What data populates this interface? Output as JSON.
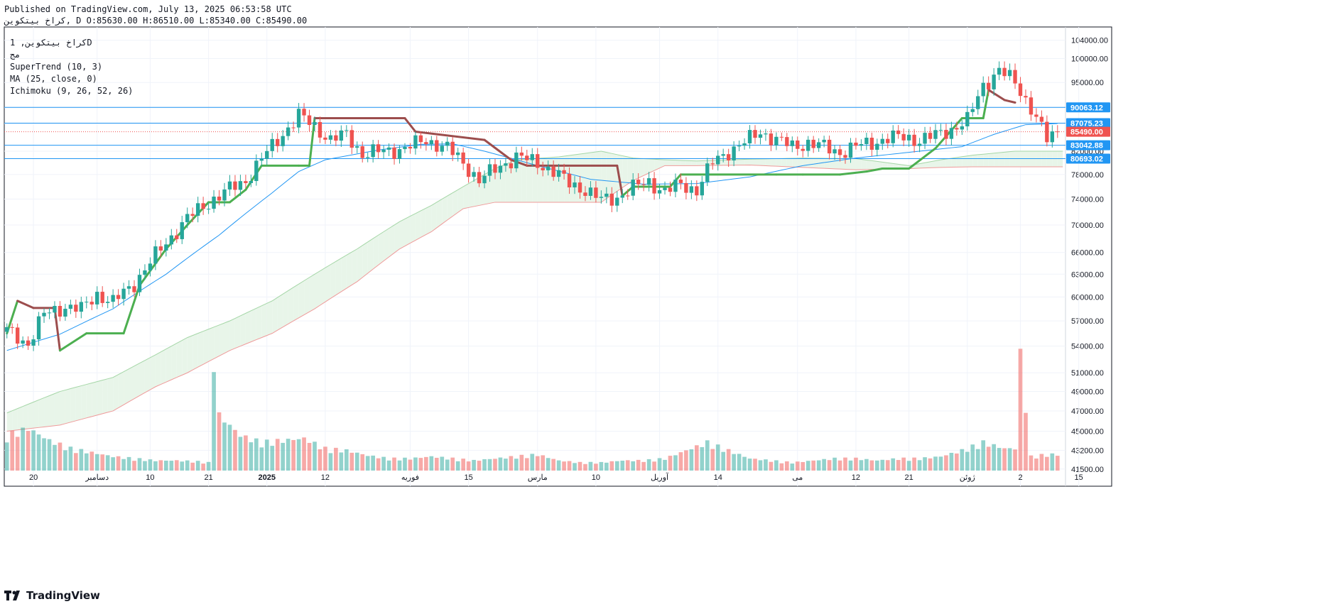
{
  "header": {
    "published": "Published on TradingView.com, July 13, 2025 06:53:58 UTC",
    "symbol_line": "كراخ بيتكوين, D O:85630.00 H:86510.00 L:85340.00 C:85490.00"
  },
  "legend": {
    "symbol": "كراخ بيتكوين, 1D",
    "exchange": "ﻣﺞ",
    "indicators": [
      "SuperTrend (10, 3)",
      "MA (25, close, 0)",
      "Ichimoku (9, 26, 52, 26)"
    ]
  },
  "footer": {
    "brand": "TradingView",
    "logo_icon": "tradingview-logo-icon"
  },
  "colors": {
    "up": "#26a69a",
    "down": "#ef5350",
    "supertrend_up": "#4caf50",
    "supertrend_down": "#9c4d4d",
    "ma": "#2196f3",
    "hline": "#2196f3",
    "current_price": "#ef5350",
    "cloud_bull": "#e8f5e9",
    "cloud_bear": "#fdecec",
    "span_a": "#a5d6a7",
    "span_b": "#ef9a9a"
  },
  "chart_data": {
    "type": "candlestick",
    "timeframe": "1D",
    "scale": "log",
    "ylim": [
      40000,
      107000
    ],
    "y_ticks": [
      "104000.00",
      "100000.00",
      "95000.00",
      "90000.00",
      "87000.00",
      "82000.00",
      "78000.00",
      "74000.00",
      "70000.00",
      "66000.00",
      "63000.00",
      "60000.00",
      "57000.00",
      "54000.00",
      "51000.00",
      "49000.00",
      "47000.00",
      "45000.00",
      "43200.00",
      "41500.00"
    ],
    "x_ticks": [
      "20",
      "دسامبر",
      "10",
      "21",
      "2025",
      "12",
      "فوريه",
      "15",
      "مارس",
      "10",
      "آوريل",
      "14",
      "مى",
      "12",
      "21",
      "ژوئن",
      "2",
      "15"
    ],
    "x_tick_index": [
      5,
      17,
      27,
      38,
      49,
      60,
      76,
      87,
      100,
      111,
      123,
      134,
      149,
      160,
      170,
      181,
      191,
      202
    ],
    "price_lines": [
      {
        "price": 90063.12,
        "label": "90063.12",
        "style": "solid"
      },
      {
        "price": 87075.23,
        "label": "87075.23",
        "style": "solid"
      },
      {
        "price": 85490.0,
        "label": "85490.00",
        "style": "dotted",
        "current": true
      },
      {
        "price": 83042.88,
        "label": "83042.88",
        "style": "solid"
      },
      {
        "price": 80693.02,
        "label": "80693.02",
        "style": "solid"
      }
    ],
    "ohlc_sample_count": 199,
    "last_ohlc": {
      "open": 85630.0,
      "high": 86510.0,
      "low": 85340.0,
      "close": 85490.0
    },
    "close_keypoints": [
      [
        0,
        55800
      ],
      [
        4,
        54300
      ],
      [
        7,
        57800
      ],
      [
        11,
        58800
      ],
      [
        14,
        58400
      ],
      [
        17,
        60400
      ],
      [
        20,
        59300
      ],
      [
        24,
        61800
      ],
      [
        29,
        66500
      ],
      [
        34,
        71000
      ],
      [
        38,
        73500
      ],
      [
        42,
        75600
      ],
      [
        45,
        77000
      ],
      [
        47,
        79500
      ],
      [
        51,
        84000
      ],
      [
        55,
        88500
      ],
      [
        58,
        86500
      ],
      [
        61,
        84000
      ],
      [
        64,
        85000
      ],
      [
        67,
        81500
      ],
      [
        71,
        82000
      ],
      [
        75,
        82500
      ],
      [
        79,
        84000
      ],
      [
        83,
        82500
      ],
      [
        86,
        80000
      ],
      [
        89,
        77000
      ],
      [
        93,
        79500
      ],
      [
        96,
        81000
      ],
      [
        100,
        80000
      ],
      [
        103,
        78500
      ],
      [
        106,
        76500
      ],
      [
        109,
        75500
      ],
      [
        112,
        73800
      ],
      [
        115,
        74300
      ],
      [
        118,
        75800
      ],
      [
        121,
        76800
      ],
      [
        124,
        75200
      ],
      [
        127,
        76300
      ],
      [
        130,
        75500
      ],
      [
        133,
        80000
      ],
      [
        136,
        82000
      ],
      [
        139,
        83500
      ],
      [
        142,
        85500
      ],
      [
        145,
        84000
      ],
      [
        148,
        82800
      ],
      [
        151,
        83500
      ],
      [
        154,
        82700
      ],
      [
        157,
        81800
      ],
      [
        160,
        82800
      ],
      [
        163,
        83500
      ],
      [
        166,
        84300
      ],
      [
        169,
        84500
      ],
      [
        172,
        84000
      ],
      [
        175,
        84800
      ],
      [
        178,
        86000
      ],
      [
        181,
        87500
      ],
      [
        184,
        94500
      ],
      [
        187,
        97500
      ],
      [
        190,
        95000
      ],
      [
        193,
        90000
      ],
      [
        196,
        84000
      ],
      [
        198,
        85490
      ]
    ],
    "ma_keypoints": [
      [
        0,
        53500
      ],
      [
        10,
        55400
      ],
      [
        20,
        58500
      ],
      [
        30,
        63000
      ],
      [
        40,
        68500
      ],
      [
        50,
        75000
      ],
      [
        55,
        78500
      ],
      [
        60,
        80500
      ],
      [
        70,
        82200
      ],
      [
        78,
        83200
      ],
      [
        84,
        83300
      ],
      [
        90,
        82000
      ],
      [
        100,
        79500
      ],
      [
        110,
        77200
      ],
      [
        120,
        76400
      ],
      [
        130,
        76500
      ],
      [
        140,
        77600
      ],
      [
        150,
        79500
      ],
      [
        160,
        80800
      ],
      [
        170,
        81800
      ],
      [
        180,
        82800
      ],
      [
        186,
        85000
      ],
      [
        192,
        86800
      ],
      [
        198,
        87000
      ]
    ],
    "supertrend_keypoints": [
      [
        0,
        55500,
        "up"
      ],
      [
        2,
        59500,
        "down"
      ],
      [
        5,
        58600,
        "down"
      ],
      [
        9,
        58600,
        "down"
      ],
      [
        10,
        53500,
        "up"
      ],
      [
        15,
        55500,
        "up"
      ],
      [
        22,
        55500,
        "up"
      ],
      [
        25,
        61500,
        "up"
      ],
      [
        30,
        66500,
        "up"
      ],
      [
        34,
        70000,
        "up"
      ],
      [
        38,
        73500,
        "up"
      ],
      [
        42,
        73500,
        "up"
      ],
      [
        45,
        75500,
        "up"
      ],
      [
        48,
        79500,
        "up"
      ],
      [
        55,
        79500,
        "up"
      ],
      [
        57,
        79500,
        "up"
      ],
      [
        58,
        88000,
        "down"
      ],
      [
        75,
        88000,
        "down"
      ],
      [
        77,
        85500,
        "down"
      ],
      [
        90,
        84000,
        "down"
      ],
      [
        95,
        80500,
        "down"
      ],
      [
        98,
        79500,
        "down"
      ],
      [
        115,
        79500,
        "down"
      ],
      [
        116,
        74500,
        "up"
      ],
      [
        118,
        76000,
        "up"
      ],
      [
        125,
        76000,
        "up"
      ],
      [
        127,
        78000,
        "up"
      ],
      [
        145,
        78000,
        "up"
      ],
      [
        150,
        78000,
        "up"
      ],
      [
        157,
        78000,
        "up"
      ],
      [
        162,
        78500,
        "up"
      ],
      [
        165,
        79000,
        "up"
      ],
      [
        170,
        79000,
        "up"
      ],
      [
        175,
        82500,
        "up"
      ],
      [
        180,
        88000,
        "up"
      ],
      [
        184,
        88000,
        "up"
      ],
      [
        185,
        93500,
        "down"
      ],
      [
        188,
        91500,
        "down"
      ],
      [
        190,
        91000,
        "down"
      ]
    ],
    "cloud_a_keypoints": [
      [
        0,
        46800
      ],
      [
        10,
        49000
      ],
      [
        20,
        50500
      ],
      [
        28,
        53000
      ],
      [
        34,
        55000
      ],
      [
        42,
        57000
      ],
      [
        50,
        59500
      ],
      [
        58,
        63000
      ],
      [
        66,
        66500
      ],
      [
        74,
        70500
      ],
      [
        80,
        73000
      ],
      [
        86,
        76000
      ],
      [
        92,
        79000
      ],
      [
        96,
        80500
      ],
      [
        104,
        81000
      ],
      [
        112,
        82000
      ],
      [
        118,
        80800
      ],
      [
        124,
        80500
      ],
      [
        130,
        80300
      ],
      [
        140,
        80600
      ],
      [
        150,
        80800
      ],
      [
        160,
        80700
      ],
      [
        170,
        79500
      ],
      [
        176,
        80500
      ],
      [
        182,
        81300
      ],
      [
        190,
        82000
      ],
      [
        198,
        82000
      ]
    ],
    "cloud_b_keypoints": [
      [
        0,
        45000
      ],
      [
        10,
        45600
      ],
      [
        20,
        47000
      ],
      [
        28,
        49500
      ],
      [
        34,
        51000
      ],
      [
        42,
        53500
      ],
      [
        50,
        55500
      ],
      [
        58,
        58500
      ],
      [
        66,
        62000
      ],
      [
        74,
        66500
      ],
      [
        80,
        69000
      ],
      [
        86,
        72500
      ],
      [
        92,
        73500
      ],
      [
        96,
        73500
      ],
      [
        104,
        73500
      ],
      [
        112,
        73500
      ],
      [
        118,
        77000
      ],
      [
        124,
        79500
      ],
      [
        130,
        79500
      ],
      [
        140,
        79600
      ],
      [
        150,
        79200
      ],
      [
        160,
        78800
      ],
      [
        170,
        79000
      ],
      [
        176,
        79200
      ],
      [
        182,
        79300
      ],
      [
        190,
        79300
      ],
      [
        198,
        79300
      ]
    ],
    "volume_keypoints": [
      [
        0,
        35
      ],
      [
        4,
        42
      ],
      [
        8,
        30
      ],
      [
        12,
        22
      ],
      [
        16,
        18
      ],
      [
        20,
        14
      ],
      [
        24,
        12
      ],
      [
        28,
        10
      ],
      [
        32,
        10
      ],
      [
        36,
        9
      ],
      [
        38,
        8
      ],
      [
        39,
        110
      ],
      [
        40,
        55
      ],
      [
        44,
        35
      ],
      [
        48,
        28
      ],
      [
        52,
        30
      ],
      [
        56,
        32
      ],
      [
        60,
        22
      ],
      [
        64,
        20
      ],
      [
        68,
        15
      ],
      [
        72,
        12
      ],
      [
        76,
        12
      ],
      [
        80,
        14
      ],
      [
        84,
        12
      ],
      [
        88,
        10
      ],
      [
        92,
        12
      ],
      [
        96,
        14
      ],
      [
        100,
        16
      ],
      [
        104,
        10
      ],
      [
        108,
        8
      ],
      [
        112,
        8
      ],
      [
        116,
        10
      ],
      [
        120,
        10
      ],
      [
        124,
        12
      ],
      [
        128,
        20
      ],
      [
        132,
        28
      ],
      [
        136,
        20
      ],
      [
        140,
        12
      ],
      [
        144,
        10
      ],
      [
        148,
        8
      ],
      [
        152,
        10
      ],
      [
        156,
        12
      ],
      [
        160,
        12
      ],
      [
        164,
        10
      ],
      [
        168,
        12
      ],
      [
        172,
        12
      ],
      [
        176,
        14
      ],
      [
        180,
        20
      ],
      [
        184,
        28
      ],
      [
        188,
        22
      ],
      [
        190,
        22
      ],
      [
        191,
        115
      ],
      [
        193,
        14
      ],
      [
        196,
        16
      ],
      [
        198,
        16
      ]
    ]
  }
}
